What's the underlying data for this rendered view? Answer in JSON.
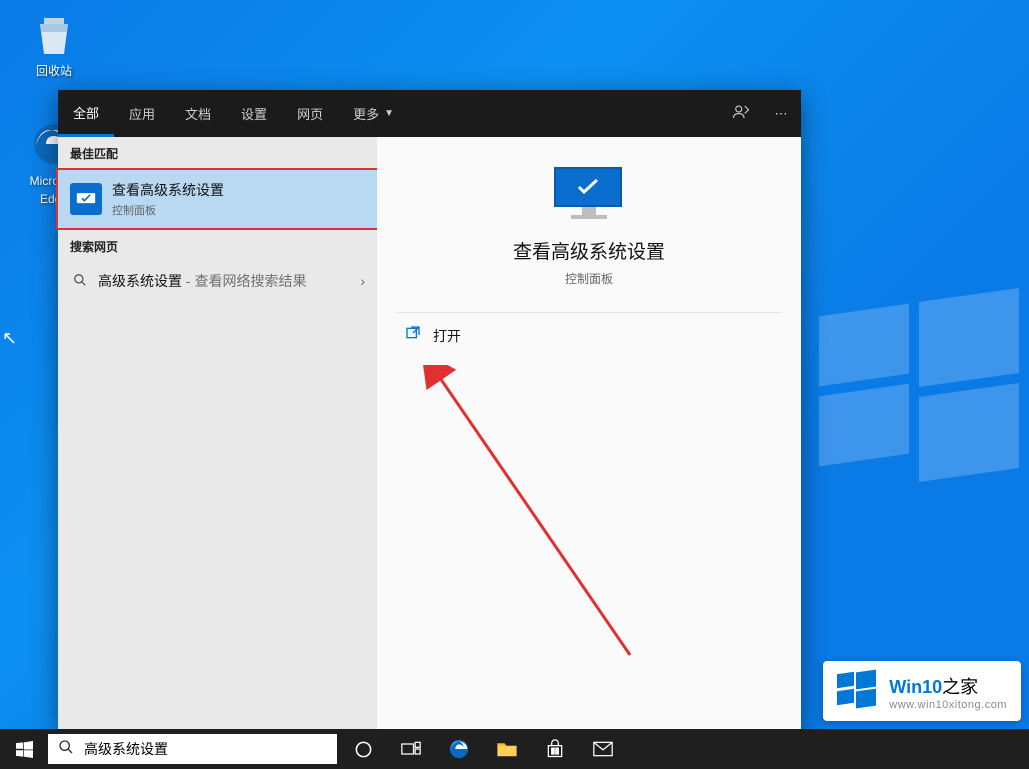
{
  "desktop": {
    "recycle_bin": "回收站",
    "edge": "Microsoft Edge"
  },
  "search_panel": {
    "tabs": [
      "全部",
      "应用",
      "文档",
      "设置",
      "网页",
      "更多"
    ],
    "sections": {
      "best_match": "最佳匹配",
      "web_search": "搜索网页"
    },
    "best_result": {
      "title": "查看高级系统设置",
      "subtitle": "控制面板"
    },
    "web_result": {
      "term": "高级系统设置",
      "suffix": " - 查看网络搜索结果"
    },
    "detail": {
      "title": "查看高级系统设置",
      "subtitle": "控制面板",
      "open_label": "打开"
    }
  },
  "taskbar": {
    "search_value": "高级系统设置"
  },
  "watermark": {
    "brand_prefix": "Win10",
    "brand_suffix": "之家",
    "url": "www.win10xitong.com"
  }
}
